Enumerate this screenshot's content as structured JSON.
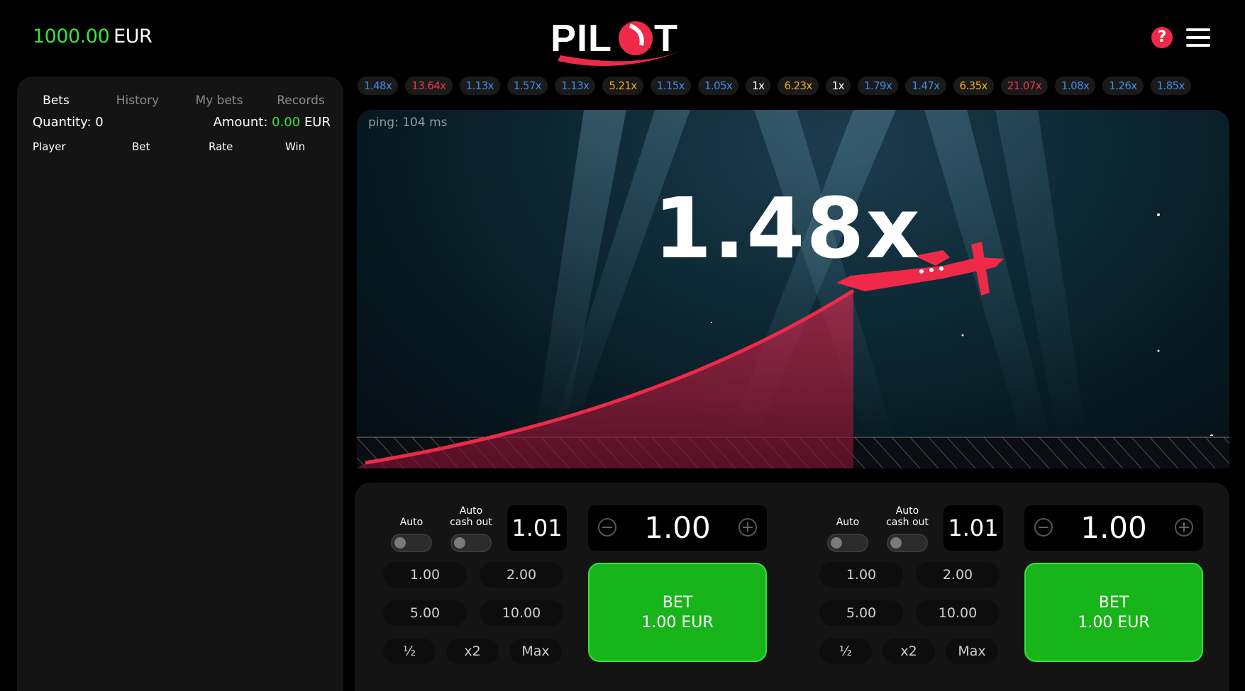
{
  "header": {
    "balance_amount": "1000.00",
    "balance_currency": "EUR",
    "logo_text": "PILOT",
    "brand_color": "#ee2a48",
    "help_icon": "question-circle-icon",
    "menu_icon": "hamburger-menu-icon"
  },
  "sidebar": {
    "tabs": [
      "Bets",
      "History",
      "My bets",
      "Records"
    ],
    "active_tab": "Bets",
    "quantity_label": "Quantity:",
    "quantity_value": "0",
    "amount_label": "Amount:",
    "amount_value": "0.00",
    "amount_currency": "EUR",
    "columns": [
      "Player",
      "Bet",
      "Rate",
      "Win"
    ]
  },
  "history": [
    {
      "text": "1.48x",
      "color": "#3b8de8"
    },
    {
      "text": "13.64x",
      "color": "#e8384f"
    },
    {
      "text": "1.13x",
      "color": "#3b8de8"
    },
    {
      "text": "1.57x",
      "color": "#3b8de8"
    },
    {
      "text": "1.13x",
      "color": "#3b8de8"
    },
    {
      "text": "5.21x",
      "color": "#f2a61f"
    },
    {
      "text": "1.15x",
      "color": "#3b8de8"
    },
    {
      "text": "1.05x",
      "color": "#3b8de8"
    },
    {
      "text": "1x",
      "color": "#ffffff"
    },
    {
      "text": "6.23x",
      "color": "#f2a61f"
    },
    {
      "text": "1x",
      "color": "#ffffff"
    },
    {
      "text": "1.79x",
      "color": "#3b8de8"
    },
    {
      "text": "1.47x",
      "color": "#3b8de8"
    },
    {
      "text": "6.35x",
      "color": "#f2a61f"
    },
    {
      "text": "21.07x",
      "color": "#e8384f"
    },
    {
      "text": "1.08x",
      "color": "#3b8de8"
    },
    {
      "text": "1.26x",
      "color": "#3b8de8"
    },
    {
      "text": "1.85x",
      "color": "#3b8de8"
    }
  ],
  "game": {
    "ping": "ping: 104 ms",
    "multiplier": "1.48x",
    "plane_icon": "red-plane-icon"
  },
  "bet_panels": [
    {
      "auto_label": "Auto",
      "auto_cashout_label_1": "Auto",
      "auto_cashout_label_2": "cash out",
      "coefficient": "1.01",
      "amount": "1.00",
      "quick_amounts": [
        "1.00",
        "2.00",
        "5.00",
        "10.00"
      ],
      "modifiers": [
        "½",
        "x2",
        "Max"
      ],
      "bet_label": "BET",
      "bet_amount": "1.00 EUR"
    },
    {
      "auto_label": "Auto",
      "auto_cashout_label_1": "Auto",
      "auto_cashout_label_2": "cash out",
      "coefficient": "1.01",
      "amount": "1.00",
      "quick_amounts": [
        "1.00",
        "2.00",
        "5.00",
        "10.00"
      ],
      "modifiers": [
        "½",
        "x2",
        "Max"
      ],
      "bet_label": "BET",
      "bet_amount": "1.00 EUR"
    }
  ]
}
